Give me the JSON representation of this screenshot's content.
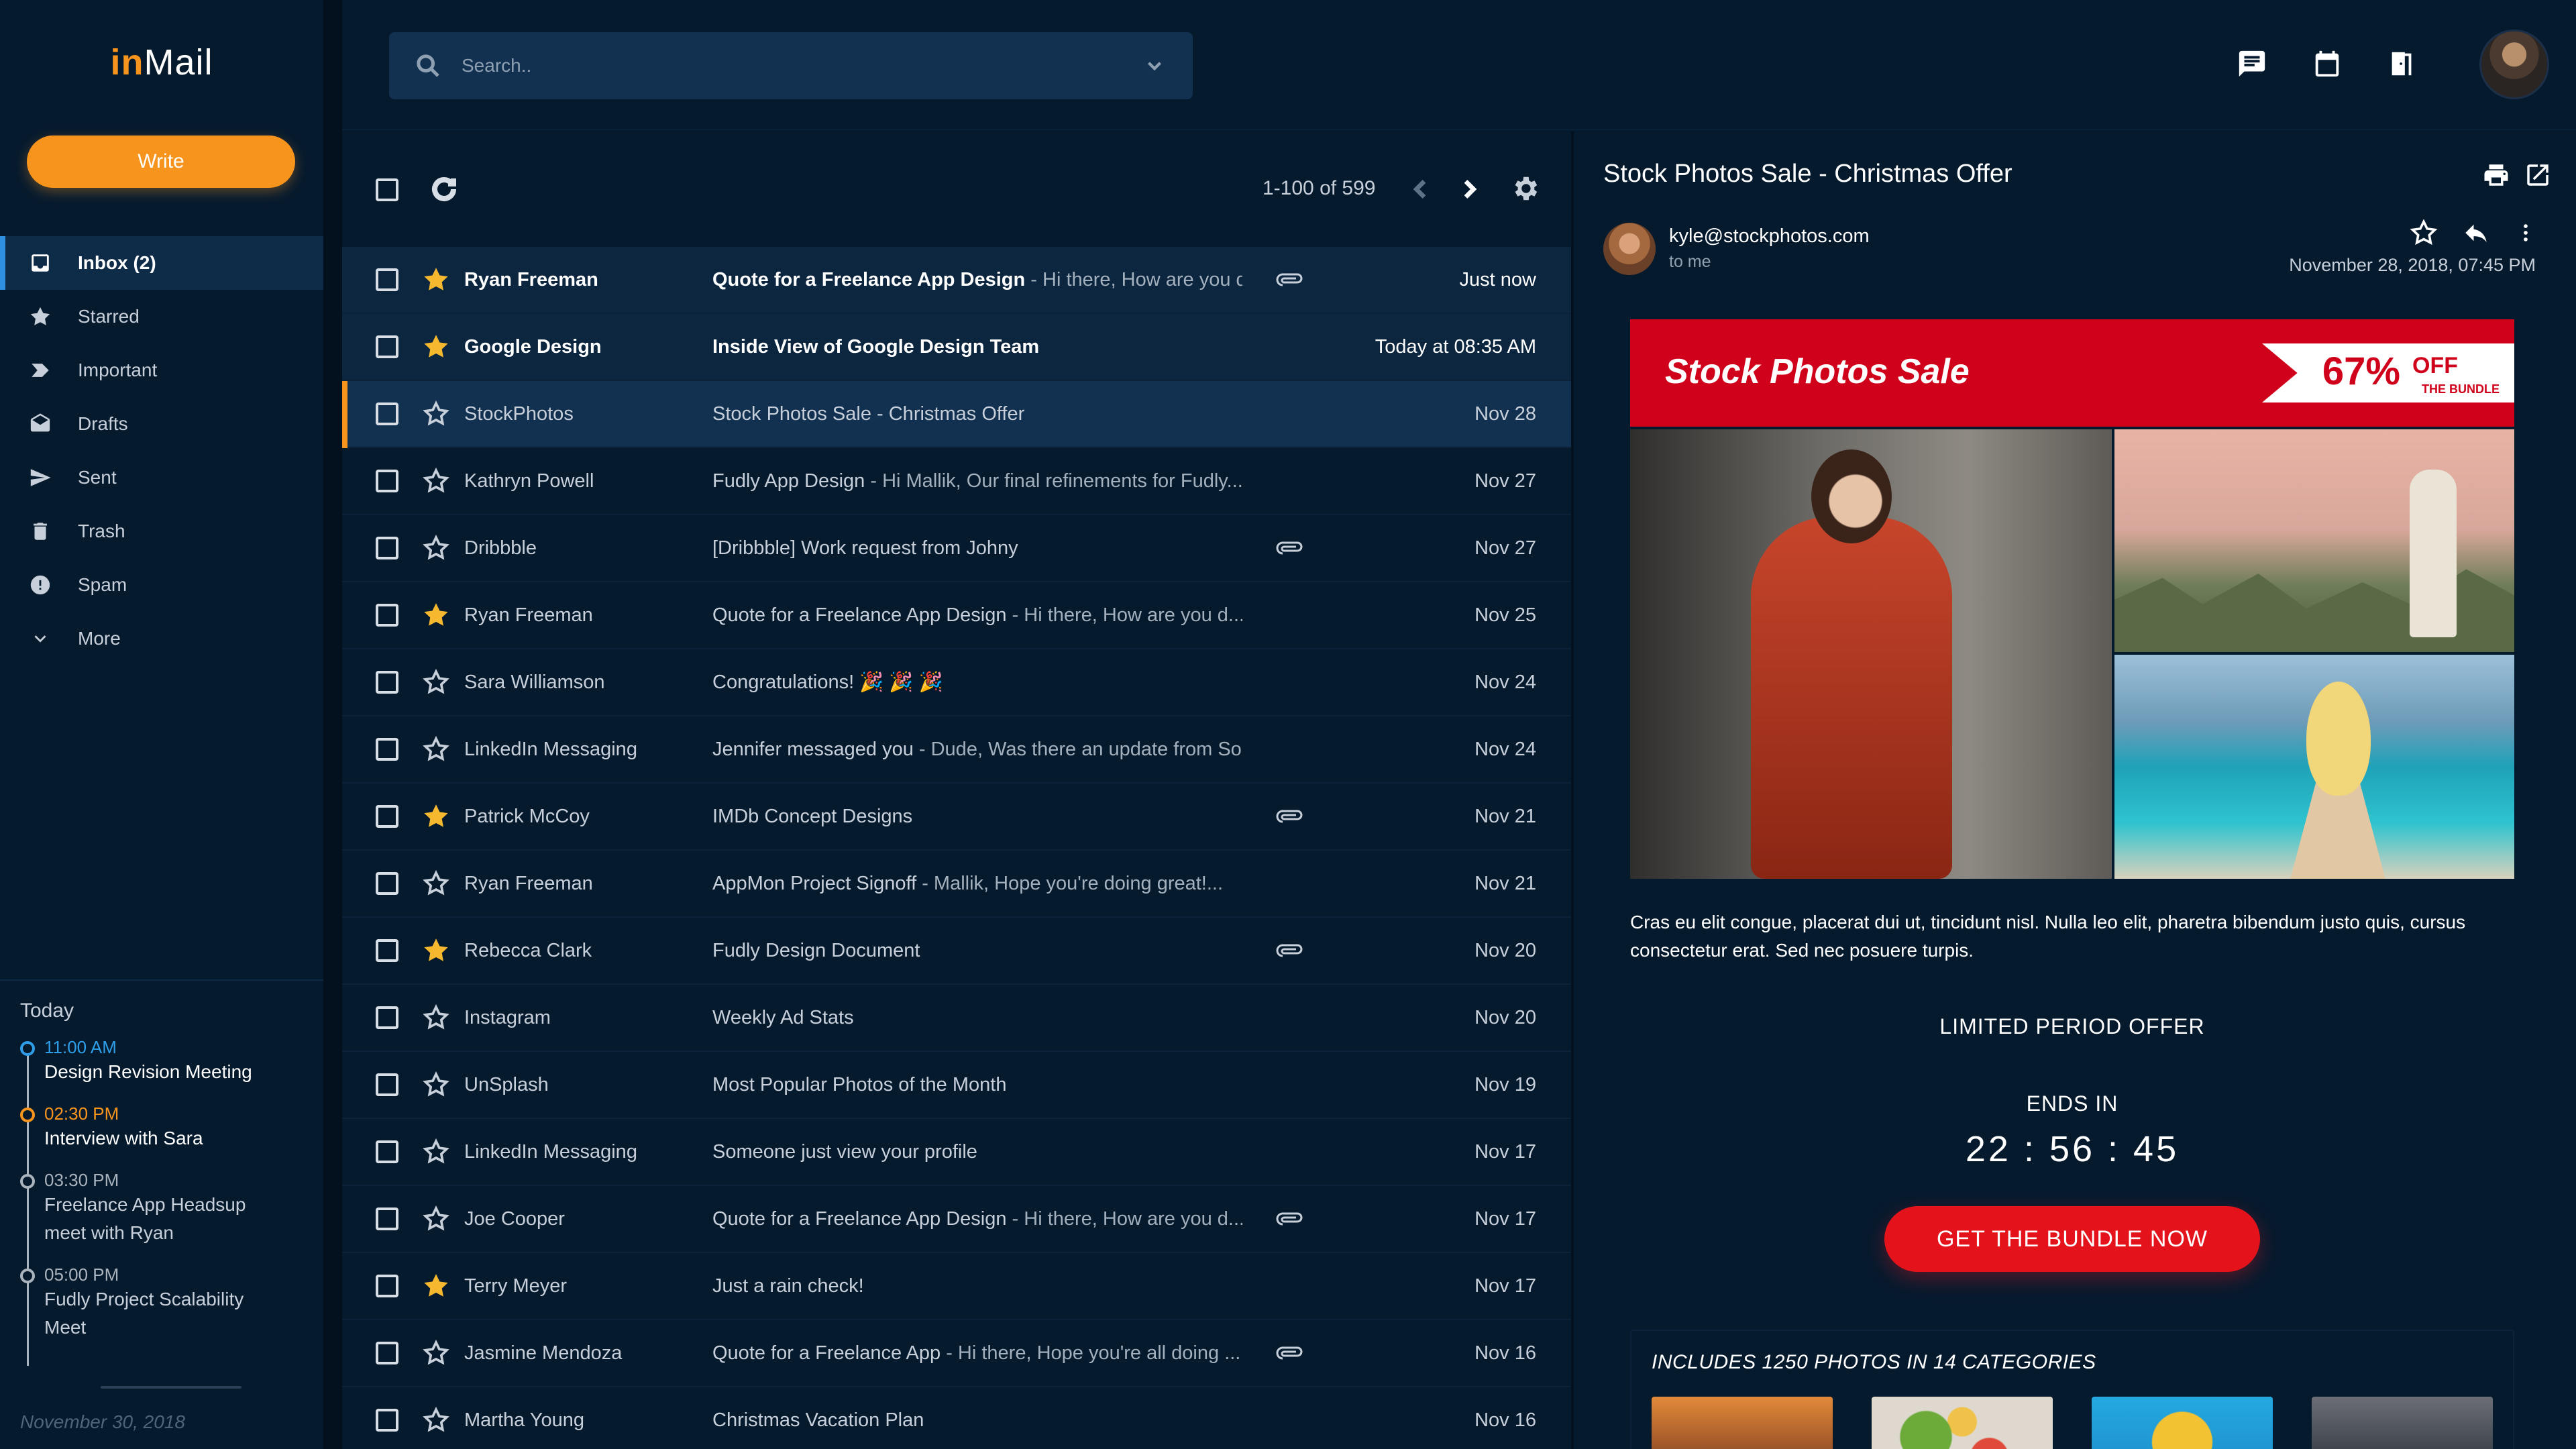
{
  "app": {
    "logo_accent": "in",
    "logo_rest": "Mail",
    "write_label": "Write"
  },
  "nav": {
    "items": [
      {
        "label": "Inbox (2)",
        "icon": "inbox-icon"
      },
      {
        "label": "Starred",
        "icon": "star-icon"
      },
      {
        "label": "Important",
        "icon": "important-icon"
      },
      {
        "label": "Drafts",
        "icon": "drafts-icon"
      },
      {
        "label": "Sent",
        "icon": "send-icon"
      },
      {
        "label": "Trash",
        "icon": "trash-icon"
      },
      {
        "label": "Spam",
        "icon": "spam-icon"
      },
      {
        "label": "More",
        "icon": "chevron-down-icon"
      }
    ]
  },
  "timeline": {
    "heading": "Today",
    "events": [
      {
        "time": "11:00 AM",
        "title": "Design Revision Meeting"
      },
      {
        "time": "02:30 PM",
        "title": "Interview with Sara"
      },
      {
        "time": "03:30 PM",
        "title": "Freelance App Headsup meet with Ryan"
      },
      {
        "time": "05:00 PM",
        "title": "Fudly Project Scalability Meet"
      }
    ],
    "date": "November 30, 2018"
  },
  "search": {
    "placeholder": "Search.."
  },
  "toolbar": {
    "pager": "1-100 of 599"
  },
  "emails": [
    {
      "sender": "Ryan Freeman",
      "subject": "Quote for a Freelance App Design",
      "snippet": " - Hi there, How are you d...",
      "date": "Just now",
      "starred": true,
      "unread": true,
      "attachment": true
    },
    {
      "sender": "Google Design",
      "subject": "Inside View of Google Design Team",
      "snippet": "",
      "date": "Today at 08:35 AM",
      "starred": true,
      "unread": true,
      "attachment": false
    },
    {
      "sender": "StockPhotos",
      "subject": "Stock Photos Sale - Christmas Offer",
      "snippet": "",
      "date": "Nov 28",
      "starred": false,
      "unread": false,
      "attachment": false,
      "selected": true
    },
    {
      "sender": "Kathryn Powell",
      "subject": "Fudly App Design",
      "snippet": " - Hi Mallik, Our final refinements for Fudly...",
      "date": "Nov 27",
      "starred": false,
      "unread": false,
      "attachment": false
    },
    {
      "sender": "Dribbble",
      "subject": "[Dribbble] Work request from Johny",
      "snippet": "",
      "date": "Nov 27",
      "starred": false,
      "unread": false,
      "attachment": true
    },
    {
      "sender": "Ryan Freeman",
      "subject": "Quote for a Freelance App Design",
      "snippet": "  - Hi there, How are you d...",
      "date": "Nov 25",
      "starred": true,
      "unread": false,
      "attachment": false
    },
    {
      "sender": "Sara Williamson",
      "subject": "Congratulations! 🎉 🎉 🎉",
      "snippet": "",
      "date": "Nov 24",
      "starred": false,
      "unread": false,
      "attachment": false
    },
    {
      "sender": "LinkedIn Messaging",
      "subject": "Jennifer messaged you",
      "snippet": "  - Dude, Was there an update from So...",
      "date": "Nov 24",
      "starred": false,
      "unread": false,
      "attachment": false
    },
    {
      "sender": "Patrick McCoy",
      "subject": "IMDb Concept Designs",
      "snippet": "",
      "date": "Nov 21",
      "starred": true,
      "unread": false,
      "attachment": true
    },
    {
      "sender": "Ryan Freeman",
      "subject": "AppMon Project Signoff",
      "snippet": "  - Mallik, Hope you're doing great!...",
      "date": "Nov 21",
      "starred": false,
      "unread": false,
      "attachment": false
    },
    {
      "sender": "Rebecca Clark",
      "subject": "Fudly Design Document",
      "snippet": "",
      "date": "Nov 20",
      "starred": true,
      "unread": false,
      "attachment": true
    },
    {
      "sender": "Instagram",
      "subject": "Weekly Ad Stats",
      "snippet": "",
      "date": "Nov 20",
      "starred": false,
      "unread": false,
      "attachment": false
    },
    {
      "sender": "UnSplash",
      "subject": "Most Popular Photos of the Month",
      "snippet": "",
      "date": "Nov 19",
      "starred": false,
      "unread": false,
      "attachment": false
    },
    {
      "sender": "LinkedIn Messaging",
      "subject": "Someone just view your profile",
      "snippet": "",
      "date": "Nov 17",
      "starred": false,
      "unread": false,
      "attachment": false
    },
    {
      "sender": "Joe Cooper",
      "subject": "Quote for a Freelance App Design",
      "snippet": "  - Hi there, How are you d...",
      "date": "Nov 17",
      "starred": false,
      "unread": false,
      "attachment": true
    },
    {
      "sender": "Terry Meyer",
      "subject": "Just a rain check!",
      "snippet": "",
      "date": "Nov 17",
      "starred": true,
      "unread": false,
      "attachment": false
    },
    {
      "sender": "Jasmine Mendoza",
      "subject": "Quote for a Freelance App",
      "snippet": " - Hi there, Hope you're all doing ...",
      "date": "Nov 16",
      "starred": false,
      "unread": false,
      "attachment": true
    },
    {
      "sender": "Martha Young",
      "subject": "Christmas Vacation Plan",
      "snippet": "",
      "date": "Nov 16",
      "starred": false,
      "unread": false,
      "attachment": false
    }
  ],
  "reading": {
    "title": "Stock Photos Sale - Christmas Offer",
    "from": "kyle@stockphotos.com",
    "to": "to me",
    "date": "November 28, 2018, 07:45 PM",
    "banner_title": "Stock Photos Sale",
    "banner_pct": "67%",
    "banner_off": "OFF",
    "banner_bundle": "THE BUNDLE",
    "body": "Cras eu elit congue, placerat dui ut, tincidunt nisl. Nulla leo elit, pharetra bibendum justo quis, cursus consectetur erat. Sed nec posuere turpis.",
    "limited": "LIMITED PERIOD OFFER",
    "ends": "ENDS IN",
    "timer": "22 : 56 : 45",
    "cta": "GET THE BUNDLE NOW",
    "includes": "INCLUDES 1250 PHOTOS IN 14 CATEGORIES"
  },
  "colors": {
    "accent": "#f7941d",
    "background": "#061a2e",
    "selected_row": "#123150",
    "promo_red": "#d0021b",
    "star": "#f5b82e"
  }
}
